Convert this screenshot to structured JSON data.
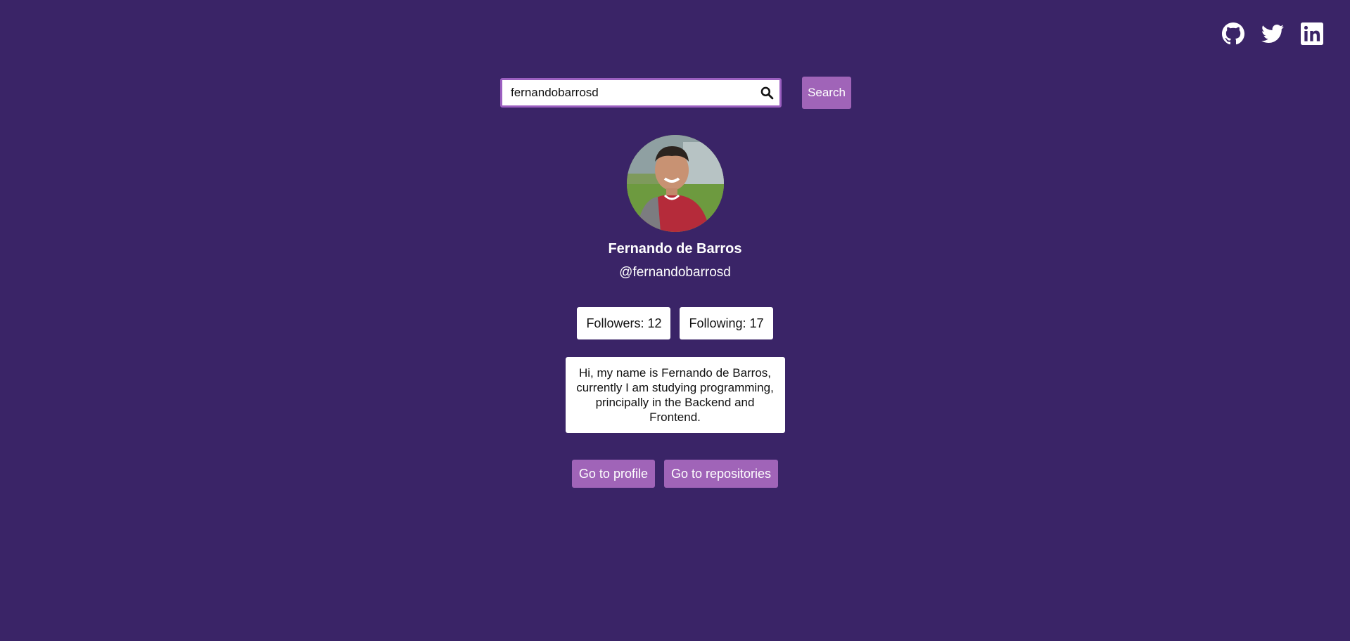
{
  "social": [
    {
      "icon": "github-icon"
    },
    {
      "icon": "twitter-icon"
    },
    {
      "icon": "linkedin-icon"
    }
  ],
  "search": {
    "value": "fernandobarrosd",
    "button_label": "Search"
  },
  "profile": {
    "name": "Fernando de Barros",
    "handle": "@fernandobarrosd",
    "followers_label": "Followers: 12",
    "following_label": "Following: 17",
    "bio": "Hi, my name is Fernando de Barros, currently I am studying programming, principally in the Backend and Frontend."
  },
  "actions": {
    "profile_label": "Go to profile",
    "repos_label": "Go to repositories"
  },
  "colors": {
    "background": "#3a2467",
    "accent": "#a064b8",
    "border": "#9b5fc0"
  }
}
